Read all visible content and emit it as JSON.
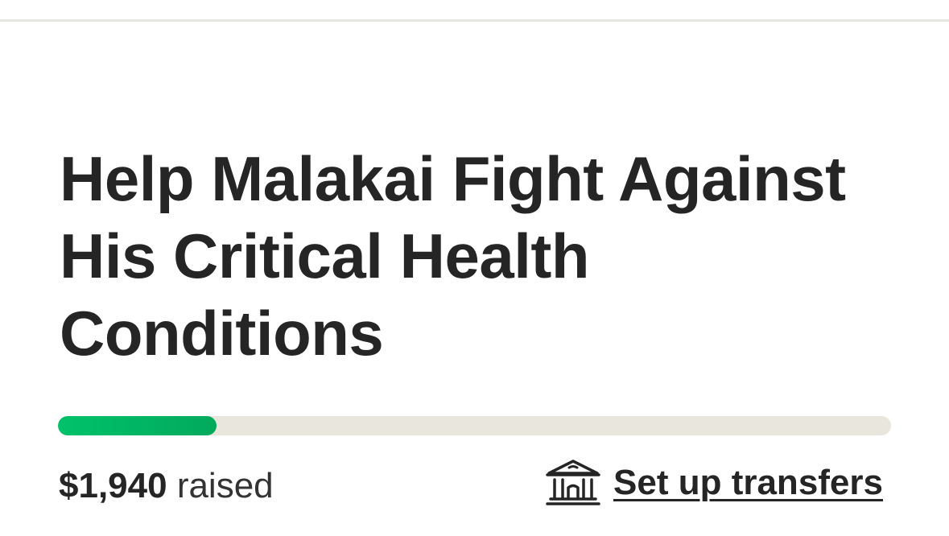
{
  "campaign": {
    "title": "Help Malakai Fight Against His Critical Health Conditions",
    "progress_fraction": 0.19,
    "amount_raised": "$1,940",
    "raised_label": "raised"
  },
  "transfers": {
    "label": "Set up transfers",
    "icon": "bank-icon"
  },
  "colors": {
    "progress_fill": "#02a95c",
    "progress_track": "#e9e6dd",
    "text": "#252525"
  }
}
